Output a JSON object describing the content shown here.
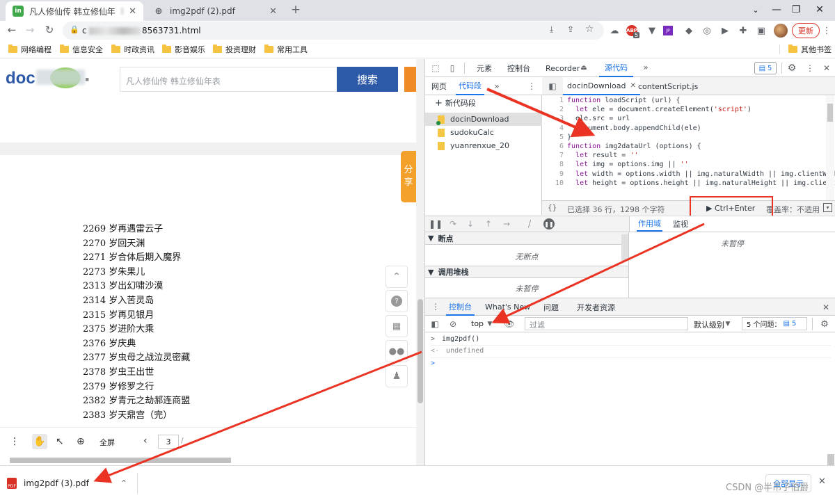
{
  "browser": {
    "tabs": [
      {
        "title": "凡人修仙传 韩立修仙年",
        "favicon_letter": "in",
        "favicon_color": "#3ea84a",
        "close": "✕"
      },
      {
        "title": "img2pdf (2).pdf",
        "favicon_letter": "⊕",
        "favicon_color": "#5f6368",
        "close": "✕"
      }
    ],
    "new_tab": "+",
    "window_controls": {
      "minimize": "—",
      "restore": "❐",
      "close": "✕"
    },
    "url_suffix": "8563731.html",
    "abp_count": "5",
    "update_button": "更新",
    "bookmarks": [
      "网络编程",
      "信息安全",
      "时政资讯",
      "影音娱乐",
      "投资理财",
      "常用工具"
    ],
    "other_bookmarks": "其他书签"
  },
  "page": {
    "search_placeholder": "凡人修仙传   韩立修仙年表",
    "search_button": "搜索",
    "share": [
      "分",
      "享"
    ],
    "doc_lines": [
      "2269 岁再遇雷云子",
      "2270 岁回天渊",
      "2271 岁合体后期入魔界",
      "2273 岁朱果儿",
      "2313 岁出幻啸沙漠",
      "2314 岁入苦灵岛",
      "2315 岁再见银月",
      "2375 岁进阶大乘",
      "2376 岁庆典",
      "2377 岁虫母之战泣灵密藏",
      "2378 岁虫王出世",
      "2379 岁修罗之行",
      "2382 岁青元之劫郝连商盟",
      "2383 岁天鼎宫（完）"
    ],
    "pdf_toolbar": {
      "fullscreen": "全屏",
      "page_number": "3",
      "page_suffix": "/"
    }
  },
  "devtools": {
    "top_tabs": [
      "元素",
      "控制台",
      "Recorder",
      "源代码"
    ],
    "selected_top_tab": "源代码",
    "issues_badge": "5",
    "nav_tabs": [
      "网页",
      "代码段"
    ],
    "new_snippet": "新代码段",
    "snippets": [
      "docinDownload",
      "sudokuCalc",
      "yuanrenxue_20"
    ],
    "editor_tabs": [
      "docinDownload",
      "contentScript.js"
    ],
    "code": [
      "function loadScript (url) {",
      "  let ele = document.createElement('script')",
      "  ele.src = url",
      "  document.body.appendChild(ele)",
      "}",
      "function img2dataUrl (options) {",
      "  let result = ''",
      "  let img = options.img || ''",
      "  let width = options.width || img.naturalWidth || img.clientWidth",
      "  let height = options.height || img.naturalHeight || img.clientHeight"
    ],
    "status": {
      "selection": "已选择 36 行，1298 个字符",
      "run": "▶ Ctrl+Enter",
      "coverage": "覆盖率：不适用"
    },
    "breakpoints_title": "断点",
    "no_breakpoints": "无断点",
    "callstack_title": "调用堆栈",
    "not_paused": "未暂停",
    "scope_tabs": [
      "作用域",
      "监视"
    ],
    "scope_not_paused": "未暂停",
    "drawer_tabs": [
      "控制台",
      "What's New",
      "问题",
      "开发者资源"
    ],
    "console_context": "top",
    "filter_placeholder": "过滤",
    "log_level": "默认级别",
    "issues_label": "5 个问题：",
    "issues_count": "5",
    "console_lines": [
      {
        "prefix": ">",
        "text": "img2pdf()"
      },
      {
        "prefix": "<·",
        "text": "undefined"
      },
      {
        "prefix": ">",
        "text": ""
      }
    ]
  },
  "download": {
    "filename": "img2pdf (3).pdf",
    "show_all": "全部显示"
  },
  "watermark": "CSDN @半吊子伯爵",
  "colors": {
    "annotation_red": "#ea3323",
    "devtools_blue": "#1a73e8",
    "search_button": "#2d5aa8"
  }
}
